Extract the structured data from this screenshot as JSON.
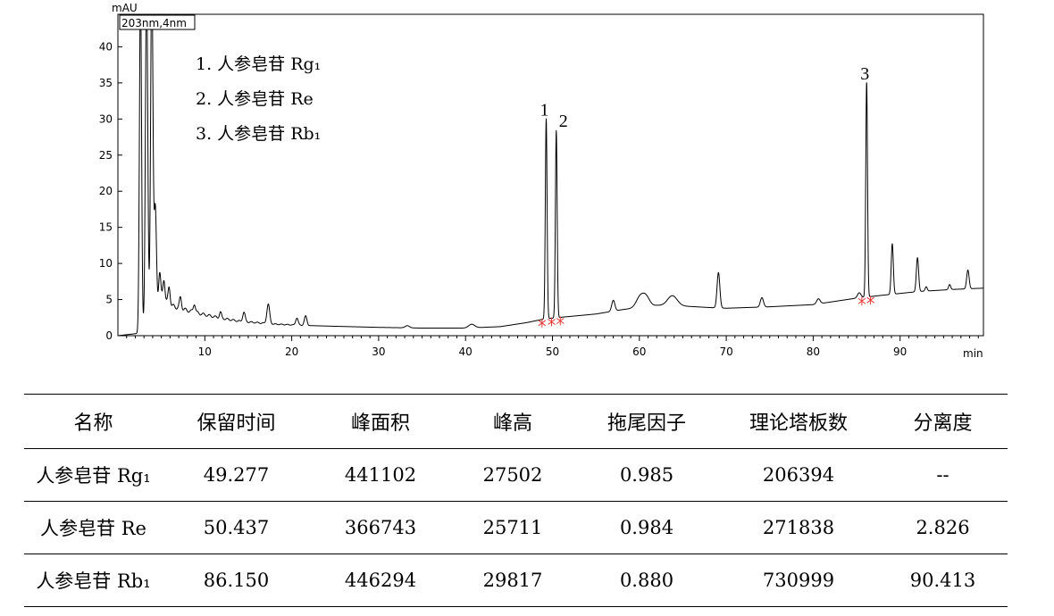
{
  "chart_data": {
    "type": "line",
    "title": "",
    "ylabel": "mAU",
    "xlabel": "min",
    "detector_label": "203nm,4nm",
    "xlim": [
      0,
      100
    ],
    "ylim": [
      0,
      45
    ],
    "x_ticks": [
      10,
      20,
      30,
      40,
      50,
      60,
      70,
      80,
      90
    ],
    "y_ticks": [
      0,
      5,
      10,
      15,
      20,
      25,
      30,
      35,
      40
    ],
    "grid": false,
    "legend_position": "top-left",
    "legend": [
      "1.  人参皂苷 Rg₁",
      "2.  人参皂苷 Re",
      "3.  人参皂苷 Rb₁"
    ],
    "peak_labels": [
      {
        "label": "1",
        "x": 49.28,
        "y": 30.0
      },
      {
        "label": "2",
        "x": 50.44,
        "y": 28.4
      },
      {
        "label": "3",
        "x": 86.15,
        "y": 35.0
      }
    ],
    "baseline": [
      [
        0,
        0
      ],
      [
        2.2,
        0.3
      ],
      [
        2.6,
        0.6
      ],
      [
        5,
        5.2
      ],
      [
        6,
        4.2
      ],
      [
        8,
        3.5
      ],
      [
        10,
        2.9
      ],
      [
        12,
        2.4
      ],
      [
        14,
        2.0
      ],
      [
        16,
        1.8
      ],
      [
        18,
        1.6
      ],
      [
        22,
        1.4
      ],
      [
        25,
        1.3
      ],
      [
        30,
        1.15
      ],
      [
        35,
        1.05
      ],
      [
        40,
        1.05
      ],
      [
        44,
        1.25
      ],
      [
        47,
        1.8
      ],
      [
        49,
        2.3
      ],
      [
        51,
        2.55
      ],
      [
        55,
        3.0
      ],
      [
        58,
        3.6
      ],
      [
        60,
        3.9
      ],
      [
        62,
        4.2
      ],
      [
        65,
        4.1
      ],
      [
        68,
        3.9
      ],
      [
        70,
        3.8
      ],
      [
        75,
        4.0
      ],
      [
        80,
        4.3
      ],
      [
        85,
        5.2
      ],
      [
        88,
        5.6
      ],
      [
        92,
        6.1
      ],
      [
        96,
        6.4
      ],
      [
        100,
        6.6
      ]
    ],
    "series": [
      {
        "peaks": [
          {
            "x": 2.6,
            "height": 48,
            "width": 0.12
          },
          {
            "x": 3.3,
            "height": 48,
            "width": 0.13
          },
          {
            "x": 3.9,
            "height": 48,
            "width": 0.13
          },
          {
            "x": 4.3,
            "height": 14,
            "width": 0.13
          },
          {
            "x": 4.8,
            "height": 4,
            "width": 0.12
          },
          {
            "x": 5.3,
            "height": 3,
            "width": 0.12
          },
          {
            "x": 5.9,
            "height": 2.5,
            "width": 0.12
          },
          {
            "x": 7.2,
            "height": 1.5,
            "width": 0.12
          },
          {
            "x": 8.8,
            "height": 1.2,
            "width": 0.12
          },
          {
            "x": 11.8,
            "height": 0.8,
            "width": 0.12
          },
          {
            "x": 14.5,
            "height": 1.3,
            "width": 0.14
          },
          {
            "x": 17.3,
            "height": 2.7,
            "width": 0.16
          },
          {
            "x": 20.6,
            "height": 1.0,
            "width": 0.14
          },
          {
            "x": 21.6,
            "height": 1.3,
            "width": 0.15
          },
          {
            "x": 33.3,
            "height": 0.3,
            "width": 0.25
          },
          {
            "x": 40.7,
            "height": 0.5,
            "width": 0.35
          },
          {
            "x": 49.28,
            "height": 27.7,
            "width": 0.1
          },
          {
            "x": 50.44,
            "height": 25.9,
            "width": 0.1
          },
          {
            "x": 57.0,
            "height": 1.5,
            "width": 0.18
          },
          {
            "x": 60.1,
            "height": 1.5,
            "width": 0.45
          },
          {
            "x": 60.8,
            "height": 1.2,
            "width": 0.4
          },
          {
            "x": 63.8,
            "height": 1.4,
            "width": 0.55
          },
          {
            "x": 69.1,
            "height": 4.9,
            "width": 0.16
          },
          {
            "x": 74.1,
            "height": 1.3,
            "width": 0.18
          },
          {
            "x": 80.6,
            "height": 0.7,
            "width": 0.2
          },
          {
            "x": 85.3,
            "height": 0.7,
            "width": 0.2
          },
          {
            "x": 86.15,
            "height": 29.8,
            "width": 0.1
          },
          {
            "x": 89.1,
            "height": 7.0,
            "width": 0.12
          },
          {
            "x": 92.0,
            "height": 4.7,
            "width": 0.13
          },
          {
            "x": 93.0,
            "height": 0.6,
            "width": 0.12
          },
          {
            "x": 95.7,
            "height": 0.7,
            "width": 0.12
          },
          {
            "x": 97.8,
            "height": 2.6,
            "width": 0.14
          }
        ]
      }
    ],
    "integration_marks": [
      48.8,
      49.9,
      50.9,
      85.6,
      86.6
    ]
  },
  "table": {
    "headers": [
      "名称",
      "保留时间",
      "峰面积",
      "峰高",
      "拖尾因子",
      "理论塔板数",
      "分离度"
    ],
    "rows": [
      [
        "人参皂苷 Rg₁",
        "49.277",
        "441102",
        "27502",
        "0.985",
        "206394",
        "--"
      ],
      [
        "人参皂苷 Re",
        "50.437",
        "366743",
        "25711",
        "0.984",
        "271838",
        "2.826"
      ],
      [
        "人参皂苷 Rb₁",
        "86.150",
        "446294",
        "29817",
        "0.880",
        "730999",
        "90.413"
      ]
    ]
  }
}
